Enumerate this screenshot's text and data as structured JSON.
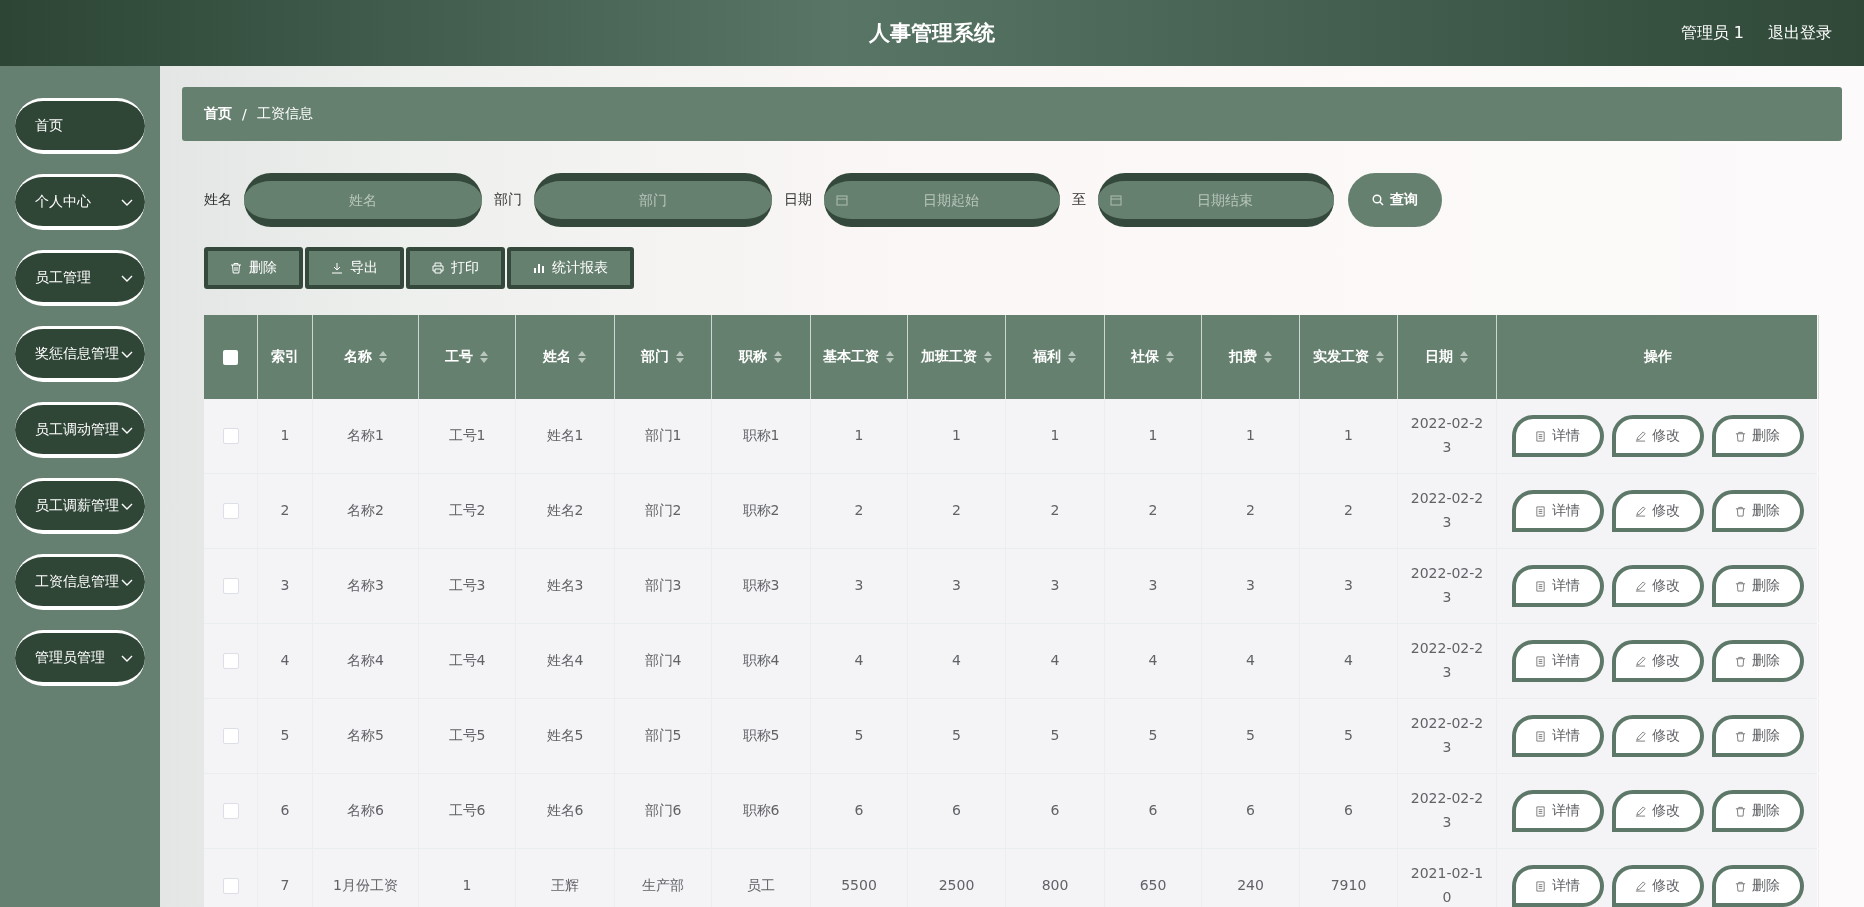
{
  "header": {
    "title": "人事管理系统",
    "user": "管理员 1",
    "logout": "退出登录"
  },
  "sidebar": {
    "items": [
      {
        "label": "首页",
        "kind": "link"
      },
      {
        "label": "个人中心",
        "kind": "submenu"
      },
      {
        "label": "员工管理",
        "kind": "submenu"
      },
      {
        "label": "奖惩信息管理",
        "kind": "submenu"
      },
      {
        "label": "员工调动管理",
        "kind": "submenu"
      },
      {
        "label": "员工调薪管理",
        "kind": "submenu"
      },
      {
        "label": "工资信息管理",
        "kind": "submenu"
      },
      {
        "label": "管理员管理",
        "kind": "submenu"
      }
    ]
  },
  "breadcrumb": {
    "items": [
      "首页",
      "工资信息"
    ],
    "separator": "/"
  },
  "search": {
    "name_label": "姓名",
    "name_placeholder": "姓名",
    "dept_label": "部门",
    "dept_placeholder": "部门",
    "date_label": "日期",
    "date_start_placeholder": "日期起始",
    "date_sep": "至",
    "date_end_placeholder": "日期结束",
    "button": "查询"
  },
  "toolbar": [
    {
      "label": "删除",
      "kind": "delete"
    },
    {
      "label": "导出",
      "kind": "export"
    },
    {
      "label": "打印",
      "kind": "print"
    },
    {
      "label": "统计报表",
      "kind": "chart"
    }
  ],
  "table": {
    "select_all_checked": false,
    "columns": [
      {
        "label": "索引",
        "sortable": false
      },
      {
        "label": "名称",
        "sortable": true
      },
      {
        "label": "工号",
        "sortable": true
      },
      {
        "label": "姓名",
        "sortable": true
      },
      {
        "label": "部门",
        "sortable": true
      },
      {
        "label": "职称",
        "sortable": true
      },
      {
        "label": "基本工资",
        "sortable": true
      },
      {
        "label": "加班工资",
        "sortable": true
      },
      {
        "label": "福利",
        "sortable": true
      },
      {
        "label": "社保",
        "sortable": true
      },
      {
        "label": "扣费",
        "sortable": true
      },
      {
        "label": "实发工资",
        "sortable": true
      },
      {
        "label": "日期",
        "sortable": true
      },
      {
        "label": "操作",
        "sortable": false
      }
    ],
    "rows": [
      {
        "checked": false,
        "cells": [
          "1",
          "名称1",
          "工号1",
          "姓名1",
          "部门1",
          "职称1",
          "1",
          "1",
          "1",
          "1",
          "1",
          "1",
          "2022-02-23"
        ],
        "actions": [
          {
            "label": "详情",
            "kind": "detail"
          },
          {
            "label": "修改",
            "kind": "edit"
          },
          {
            "label": "删除",
            "kind": "delete"
          }
        ]
      },
      {
        "checked": false,
        "cells": [
          "2",
          "名称2",
          "工号2",
          "姓名2",
          "部门2",
          "职称2",
          "2",
          "2",
          "2",
          "2",
          "2",
          "2",
          "2022-02-23"
        ],
        "actions": [
          {
            "label": "详情",
            "kind": "detail"
          },
          {
            "label": "修改",
            "kind": "edit"
          },
          {
            "label": "删除",
            "kind": "delete"
          }
        ]
      },
      {
        "checked": false,
        "cells": [
          "3",
          "名称3",
          "工号3",
          "姓名3",
          "部门3",
          "职称3",
          "3",
          "3",
          "3",
          "3",
          "3",
          "3",
          "2022-02-23"
        ],
        "actions": [
          {
            "label": "详情",
            "kind": "detail"
          },
          {
            "label": "修改",
            "kind": "edit"
          },
          {
            "label": "删除",
            "kind": "delete"
          }
        ]
      },
      {
        "checked": false,
        "cells": [
          "4",
          "名称4",
          "工号4",
          "姓名4",
          "部门4",
          "职称4",
          "4",
          "4",
          "4",
          "4",
          "4",
          "4",
          "2022-02-23"
        ],
        "actions": [
          {
            "label": "详情",
            "kind": "detail"
          },
          {
            "label": "修改",
            "kind": "edit"
          },
          {
            "label": "删除",
            "kind": "delete"
          }
        ]
      },
      {
        "checked": false,
        "cells": [
          "5",
          "名称5",
          "工号5",
          "姓名5",
          "部门5",
          "职称5",
          "5",
          "5",
          "5",
          "5",
          "5",
          "5",
          "2022-02-23"
        ],
        "actions": [
          {
            "label": "详情",
            "kind": "detail"
          },
          {
            "label": "修改",
            "kind": "edit"
          },
          {
            "label": "删除",
            "kind": "delete"
          }
        ]
      },
      {
        "checked": false,
        "cells": [
          "6",
          "名称6",
          "工号6",
          "姓名6",
          "部门6",
          "职称6",
          "6",
          "6",
          "6",
          "6",
          "6",
          "6",
          "2022-02-23"
        ],
        "actions": [
          {
            "label": "详情",
            "kind": "detail"
          },
          {
            "label": "修改",
            "kind": "edit"
          },
          {
            "label": "删除",
            "kind": "delete"
          }
        ]
      },
      {
        "checked": false,
        "cells": [
          "7",
          "1月份工资",
          "1",
          "王辉",
          "生产部",
          "员工",
          "5500",
          "2500",
          "800",
          "650",
          "240",
          "7910",
          "2021-02-10"
        ],
        "actions": [
          {
            "label": "详情",
            "kind": "detail"
          },
          {
            "label": "修改",
            "kind": "edit"
          },
          {
            "label": "删除",
            "kind": "delete"
          }
        ]
      }
    ]
  }
}
